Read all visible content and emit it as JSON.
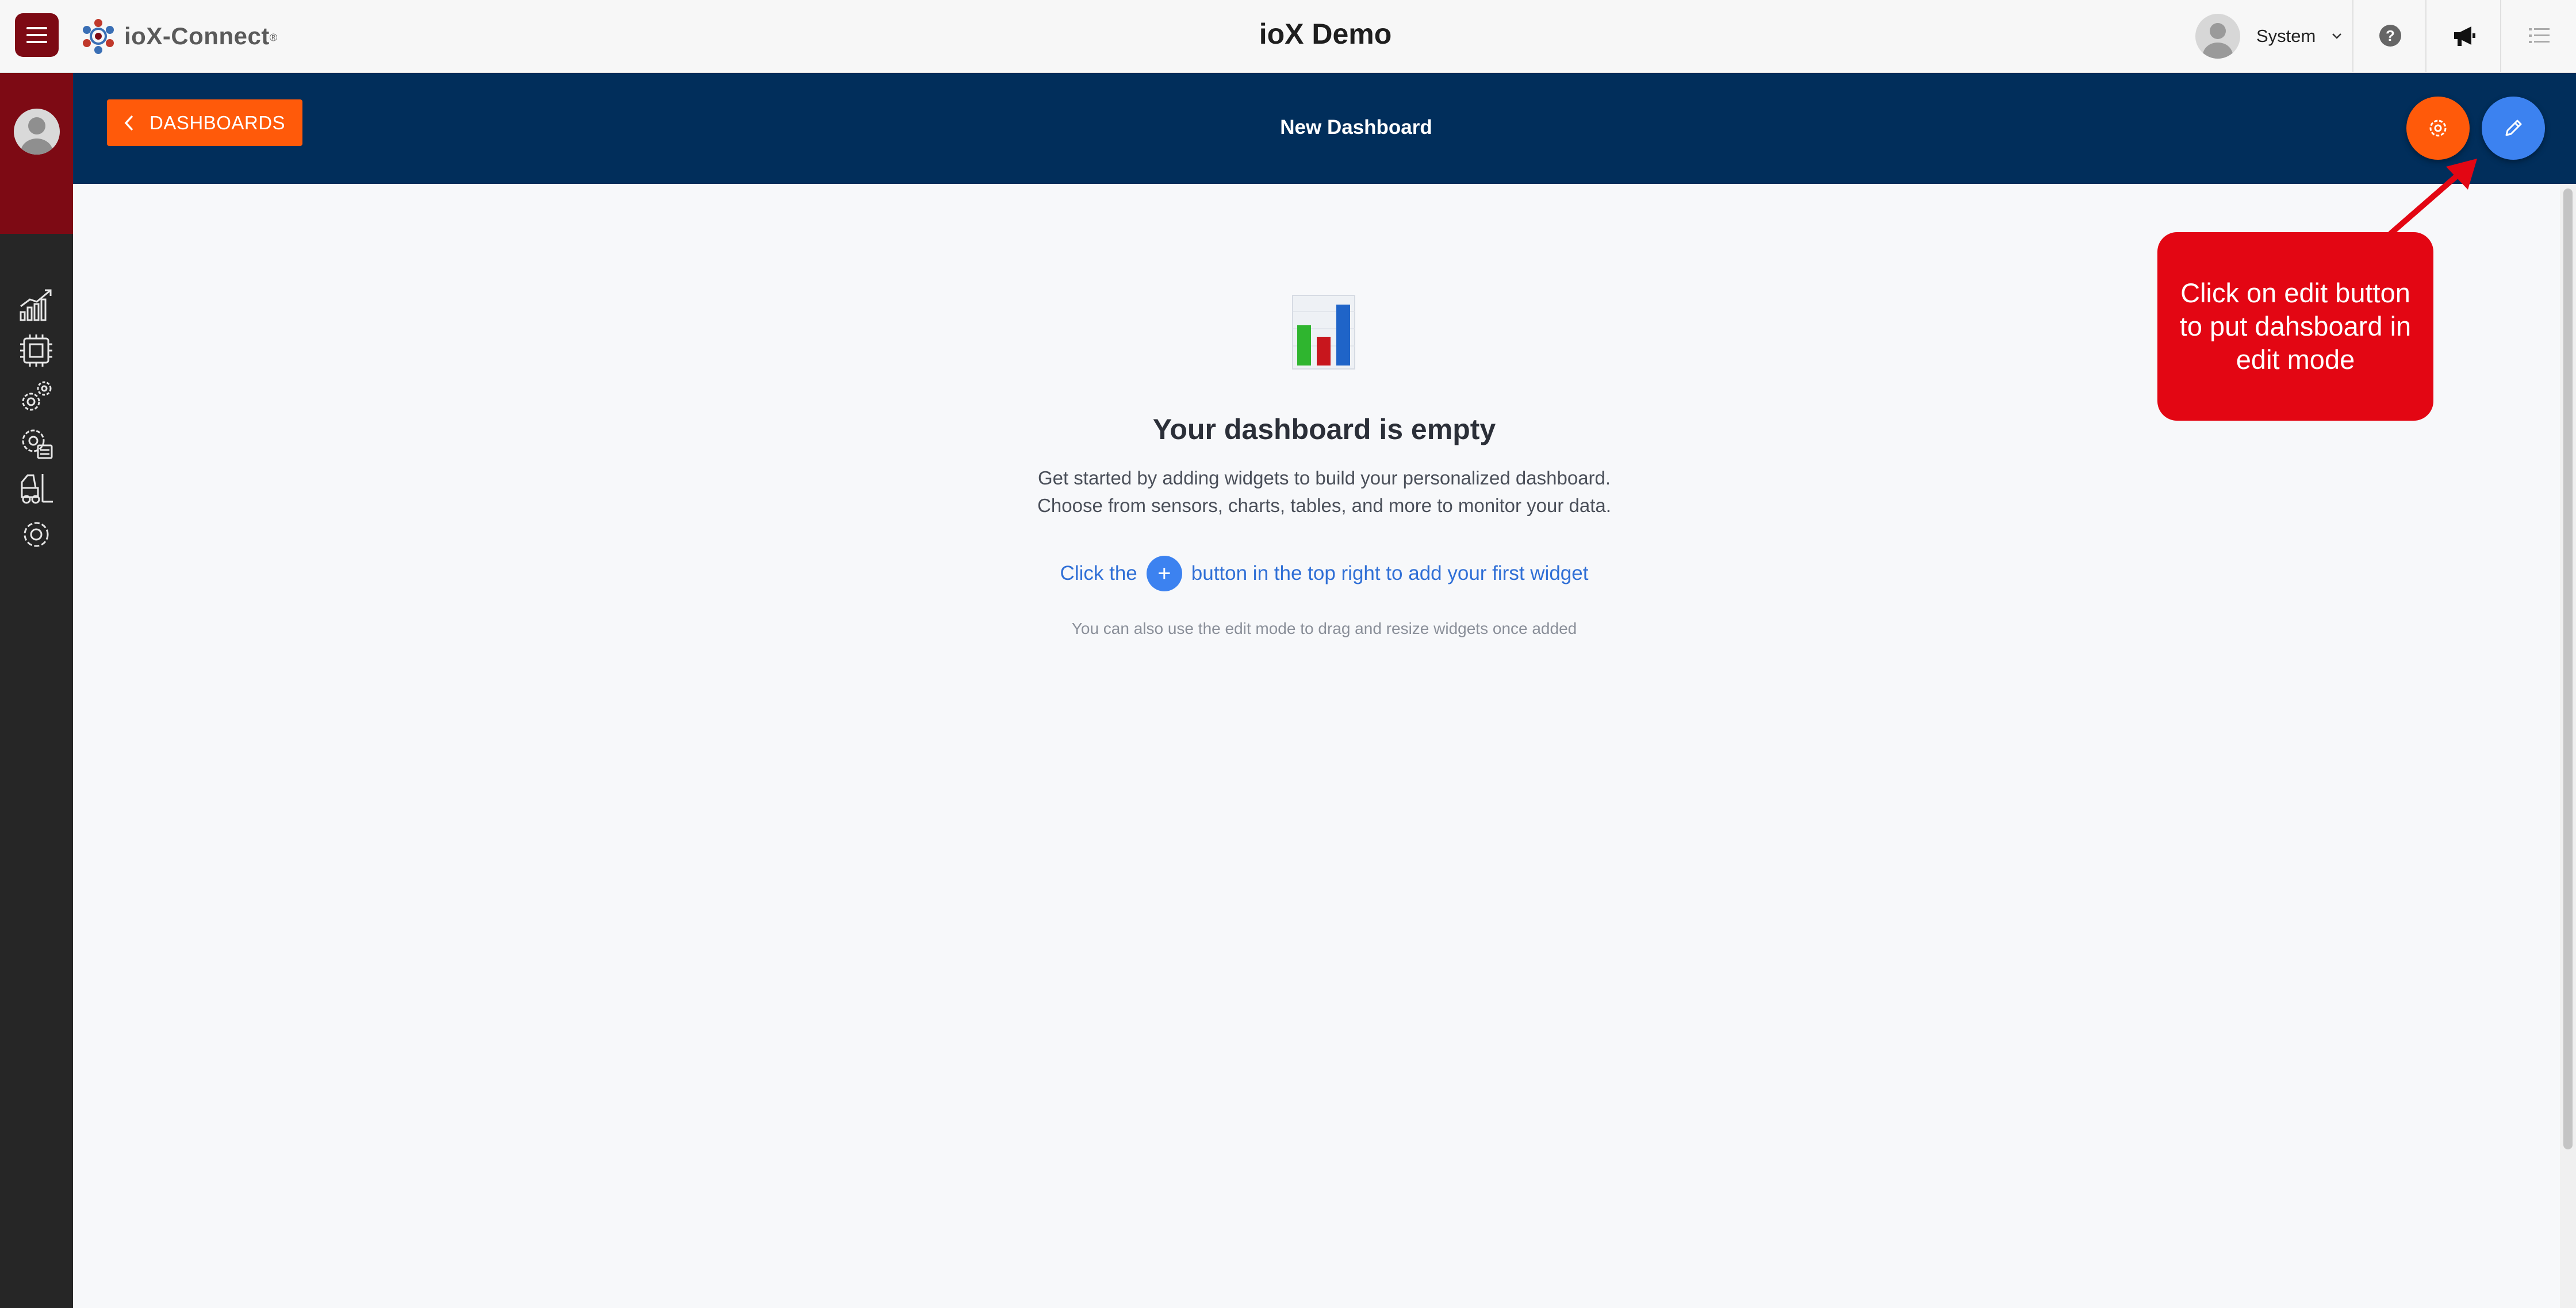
{
  "topbar": {
    "brand": "ioX-Connect",
    "brand_mark": "®",
    "title": "ioX Demo",
    "user_name": "System"
  },
  "banner": {
    "back_label": "DASHBOARDS",
    "title": "New Dashboard"
  },
  "empty_state": {
    "title": "Your dashboard is empty",
    "desc_line1": "Get started by adding widgets to build your personalized dashboard.",
    "desc_line2": "Choose from sensors, charts, tables, and more to monitor your data.",
    "hint_before": "Click the",
    "hint_plus": "+",
    "hint_after": "button in the top right to add your first widget",
    "subhint": "You can also use the edit mode to drag and resize widgets once added"
  },
  "callout": {
    "text": "Click on edit button to put dahsboard in edit mode"
  },
  "colors": {
    "brand_dark_red": "#7d0a14",
    "banner_navy": "#012e5b",
    "accent_orange": "#ff5a0a",
    "accent_blue": "#3c82f0",
    "callout_red": "#e30613",
    "sidebar_dark": "#262626"
  },
  "icons": {
    "menu": "hamburger-menu-icon",
    "help": "help-circle-icon",
    "announce": "megaphone-icon",
    "list": "list-icon",
    "sidebar": [
      "analytics-chart-icon",
      "devices-chip-icon",
      "device-settings-icon",
      "asset-settings-icon",
      "forklift-icon",
      "settings-gear-icon"
    ]
  }
}
